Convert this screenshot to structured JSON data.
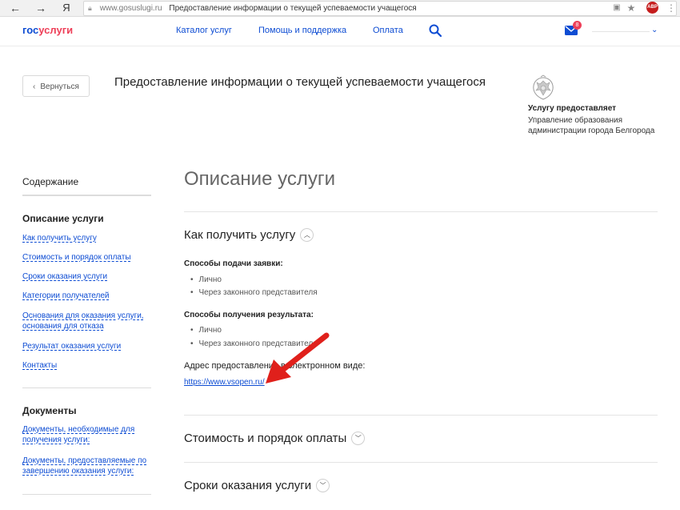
{
  "browser": {
    "domain": "www.gosuslugi.ru",
    "page_title": "Предоставление информации о текущей успеваемости учащегося",
    "yandex_label": "Я",
    "abp_label": "ABP"
  },
  "header": {
    "logo_part1": "гос",
    "logo_part2": "услуги",
    "nav": [
      "Каталог услуг",
      "Помощь и поддержка",
      "Оплата"
    ],
    "mail_badge": "8"
  },
  "page": {
    "back_label": "Вернуться",
    "title": "Предоставление информации о текущей успеваемости учащегося",
    "provider_title": "Услугу предоставляет",
    "provider_name": "Управление образования администрации города Белгорода"
  },
  "sidebar": {
    "toc_title": "Содержание",
    "section1_title": "Описание услуги",
    "section1_links": [
      "Как получить услугу",
      "Стоимость и порядок оплаты",
      "Сроки оказания услуги",
      "Категории получателей",
      "Основания для оказания услуги, основания для отказа",
      "Результат оказания услуги",
      "Контакты"
    ],
    "section2_title": "Документы",
    "section2_links": [
      "Документы, необходимые для получения услуги:",
      "Документы, предоставляемые по завершению оказания услуги:"
    ]
  },
  "main": {
    "heading": "Описание услуги",
    "how_title": "Как получить услугу",
    "submit_title": "Способы подачи заявки:",
    "submit_items": [
      "Лично",
      "Через законного представителя"
    ],
    "result_title": "Способы получения результата:",
    "result_items": [
      "Лично",
      "Через законного представителя"
    ],
    "address_label": "Адрес предоставления в электронном виде:",
    "address_link": "https://www.vsopen.ru/",
    "cost_title": "Стоимость и порядок оплаты",
    "terms_title": "Сроки оказания услуги"
  },
  "colors": {
    "accent": "#0d4cd3",
    "brand_red": "#ee3f58",
    "arrow": "#e0201b"
  }
}
